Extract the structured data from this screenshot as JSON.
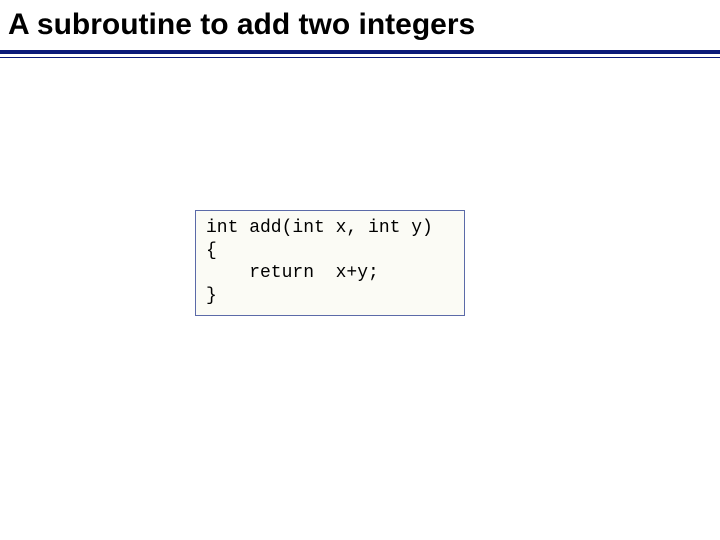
{
  "slide": {
    "title": "A subroutine to add two integers",
    "code": "int add(int x, int y)\n{\n    return  x+y;\n}"
  }
}
